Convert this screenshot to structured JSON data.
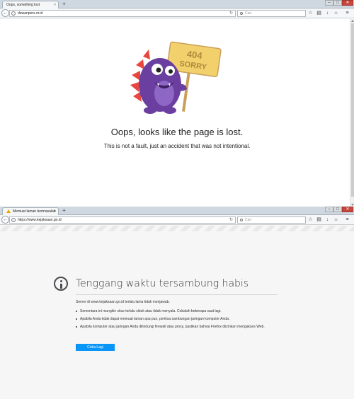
{
  "window1": {
    "tab_title": "Oops, something lost",
    "url": "dewanpers.or.id",
    "search_placeholder": "Cari",
    "new_tab_label": "+",
    "close_tab_label": "×",
    "sign_text": [
      "404",
      "SORRY"
    ],
    "heading": "Oops, looks like the page is lost.",
    "subheading": "This is not a fault, just an accident that was not intentional."
  },
  "window2": {
    "tab_title": "Memuat laman bermasalah",
    "url": "https://www.kejaksaan.go.id",
    "search_placeholder": "Cari",
    "new_tab_label": "+",
    "close_tab_label": "×",
    "error_title": "Tenggang waktu tersambung habis",
    "error_description": "Server di www.kejaksaan.go.id terlalu lama tidak menjawab.",
    "error_items": [
      "Sementara ini mungkin situs terlalu sibuk atau tidak menyala. Cobalah beberapa saat lagi.",
      "Apabila Anda tidak dapat memuat laman apa pun, periksa sambungan jaringan komputer Anda.",
      "Apabila komputer atau jaringan Anda dilindungi firewall atau proxy, pastikan bahwa Firefox diizinkan mengakses Web."
    ],
    "retry_button": "Coba Lagi"
  },
  "toolbar_icons": [
    "star-icon",
    "clipboard-icon",
    "download-icon",
    "home-icon",
    "menu-icon"
  ],
  "colors": {
    "monster_purple": "#6a3fa0",
    "monster_spikes": "#e8473f",
    "sign_yellow": "#f2d06b",
    "retry_blue": "#0996f8"
  }
}
